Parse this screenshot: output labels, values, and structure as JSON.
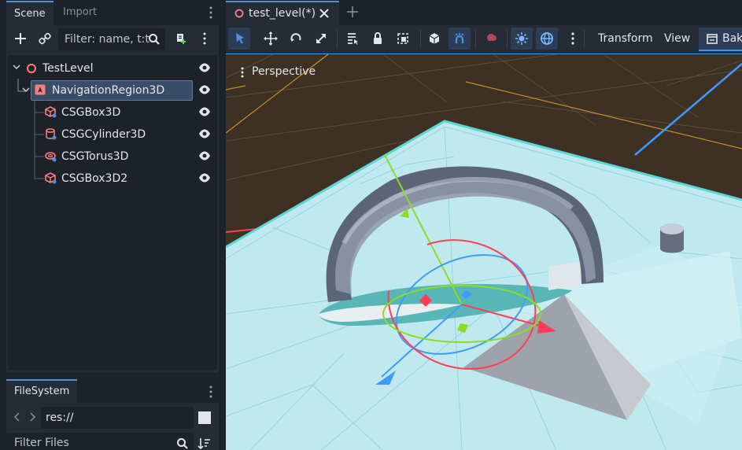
{
  "scene_dock": {
    "tabs": [
      "Scene",
      "Import"
    ],
    "filter_placeholder": "Filter: name, t:t",
    "tree": [
      {
        "label": "TestLevel",
        "icon": "node3d-icon"
      },
      {
        "label": "NavigationRegion3D",
        "icon": "navigation-region-icon",
        "selected": true
      },
      {
        "label": "CSGBox3D",
        "icon": "csg-box-icon"
      },
      {
        "label": "CSGCylinder3D",
        "icon": "csg-cylinder-icon"
      },
      {
        "label": "CSGTorus3D",
        "icon": "csg-torus-icon"
      },
      {
        "label": "CSGBox3D2",
        "icon": "csg-box-icon"
      }
    ]
  },
  "filesystem_dock": {
    "tab": "FileSystem",
    "path": "res://",
    "filter_placeholder": "Filter Files"
  },
  "editor": {
    "tab_title": "test_level(*)",
    "menu": {
      "transform": "Transform",
      "view": "View",
      "bake": "Bak"
    },
    "viewport_label": "Perspective"
  },
  "colors": {
    "accent": "#4d8fe3",
    "selection": "#3a4d67",
    "axis_x": "#ff3d56",
    "axis_y": "#8bdc26",
    "axis_z": "#3d9bff",
    "node_icon": "#fc7f7f"
  }
}
